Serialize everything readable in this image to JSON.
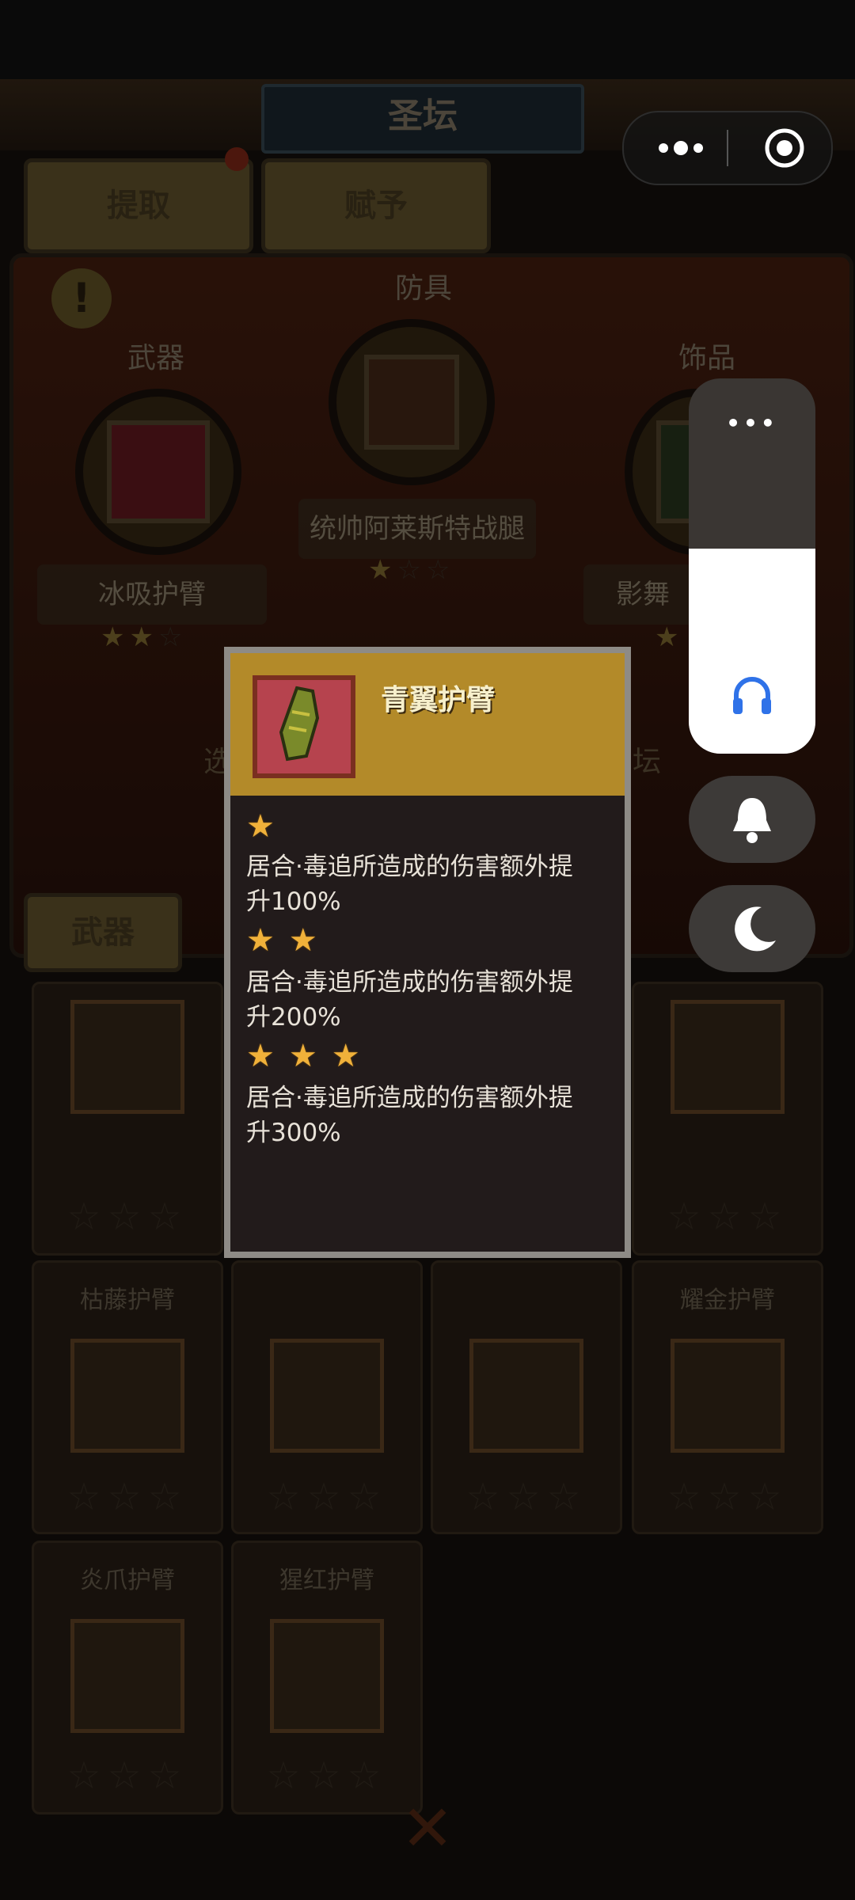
{
  "colors": {
    "popup_header": "#b38a29",
    "popup_border": "#8e8b86",
    "star_gold": "#f0b13a",
    "volume_fill": "#ffffff",
    "headphone_blue": "#2f72e8"
  },
  "header": {
    "title": "圣坛"
  },
  "tabs": [
    {
      "label": "提取"
    },
    {
      "label": "赋予"
    }
  ],
  "altar": {
    "center": {
      "category": "防具",
      "item_name": "统帅阿莱斯特战腿",
      "stars_filled": 1,
      "icon": "boots-icon"
    },
    "left": {
      "category": "武器",
      "item_name": "冰吸护臂",
      "stars_filled": 2,
      "icon": "ice-gauntlet-icon"
    },
    "right": {
      "category": "饰品",
      "item_name": "影舞",
      "stars_filled": 1,
      "icon": "accessory-icon"
    },
    "partial_text_left": "选",
    "partial_text_right": "坛"
  },
  "filter_button": {
    "label": "武器"
  },
  "grid": {
    "items": [
      {
        "name": "",
        "icon": "blade-icon"
      },
      {
        "name": "",
        "icon": "gauntlet-icon"
      },
      {
        "name": "",
        "icon": "gauntlet-icon"
      },
      {
        "name": "",
        "icon": "blue-gauntlet-icon"
      },
      {
        "name": "枯藤护臂",
        "icon": "vine-gauntlet-icon"
      },
      {
        "name": "",
        "icon": "green-gauntlet-icon"
      },
      {
        "name": "",
        "icon": "bone-gauntlet-icon"
      },
      {
        "name": "耀金护臂",
        "icon": "gold-gauntlet-icon"
      },
      {
        "name": "炎爪护臂",
        "icon": "claw-gauntlet-icon"
      },
      {
        "name": "猩红护臂",
        "icon": "crimson-gauntlet-icon"
      }
    ],
    "star_symbol": "☆☆☆"
  },
  "popup": {
    "item_name": "青翼护臂",
    "icon": "green-gauntlet-icon",
    "tiers": [
      {
        "stars": "★",
        "desc": "居合·毒追所造成的伤害额外提升100%"
      },
      {
        "stars": "★★",
        "desc": "居合·毒追所造成的伤害额外提升200%"
      },
      {
        "stars": "★★★",
        "desc": "居合·毒追所造成的伤害额外提升300%"
      }
    ]
  },
  "close_button": {
    "label": "✕"
  },
  "system": {
    "more_icon": "more-dots-icon",
    "target_icon": "target-icon",
    "volume_more": "•••",
    "volume_level": 0.55,
    "volume_icon": "headphones-icon",
    "bell_icon": "bell-icon",
    "moon_icon": "moon-icon"
  }
}
